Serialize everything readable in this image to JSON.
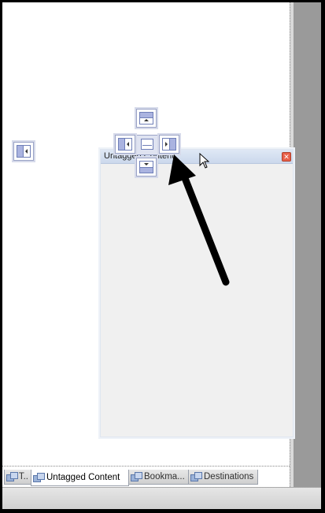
{
  "panel": {
    "title": "Untagged Content",
    "close_glyph": "✕"
  },
  "tabs": [
    {
      "label": "T..",
      "icon": "panel-tab-icon"
    },
    {
      "label": "Untagged Content",
      "icon": "panel-tab-icon",
      "active": true
    },
    {
      "label": "Bookma...",
      "icon": "panel-tab-icon"
    },
    {
      "label": "Destinations",
      "icon": "panel-tab-icon"
    }
  ],
  "dock_targets": [
    "dock-left",
    "dock-top",
    "dock-center",
    "dock-right",
    "dock-bottom",
    "dock-far-left"
  ],
  "colors": {
    "title_bar": "#cbd8ec",
    "dock_fill": "#aab3e0",
    "close": "#e8604a"
  }
}
